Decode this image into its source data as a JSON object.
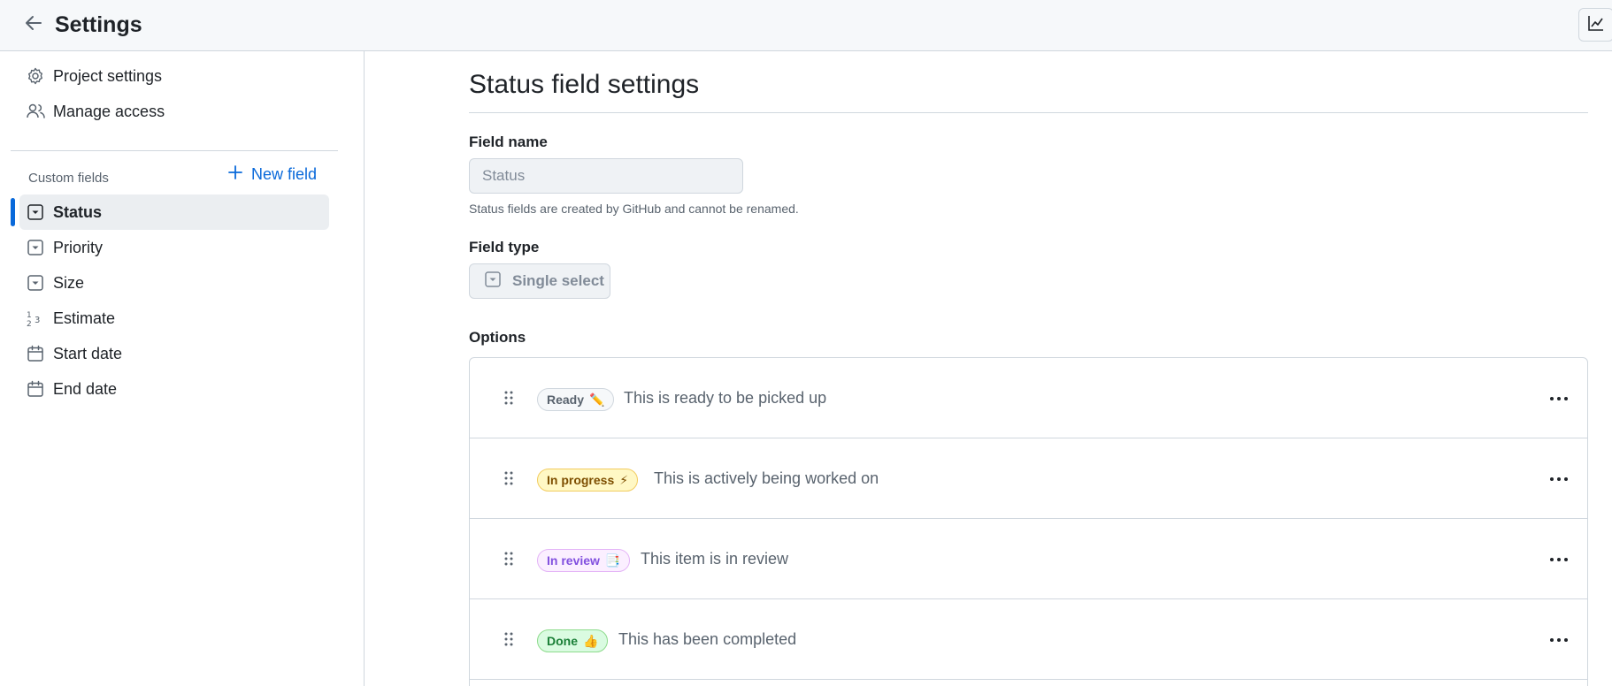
{
  "header": {
    "title": "Settings",
    "back_icon": "arrow-left-icon",
    "insights_icon": "graph-icon"
  },
  "sidebar": {
    "top_items": [
      {
        "label": "Project settings",
        "icon": "gear-icon"
      },
      {
        "label": "Manage access",
        "icon": "people-icon"
      }
    ],
    "section_label": "Custom fields",
    "new_field_label": "New field",
    "fields": [
      {
        "label": "Status",
        "icon": "single-select-icon",
        "active": true
      },
      {
        "label": "Priority",
        "icon": "single-select-icon",
        "active": false
      },
      {
        "label": "Size",
        "icon": "single-select-icon",
        "active": false
      },
      {
        "label": "Estimate",
        "icon": "number-icon",
        "active": false
      },
      {
        "label": "Start date",
        "icon": "calendar-icon",
        "active": false
      },
      {
        "label": "End date",
        "icon": "calendar-icon",
        "active": false
      }
    ],
    "accent_color": "#0969da"
  },
  "main": {
    "title": "Status field settings",
    "field_name_label": "Field name",
    "field_name_value": "Status",
    "field_name_hint": "Status fields are created by GitHub and cannot be renamed.",
    "field_type_label": "Field type",
    "field_type_value": "Single select",
    "options_label": "Options",
    "options": [
      {
        "name": "Ready",
        "emoji": "✏️",
        "description": "This is ready to be picked up",
        "bg": "#f6f8fa",
        "border": "#d0d7de",
        "color": "#59636e"
      },
      {
        "name": "In progress",
        "emoji": "⚡",
        "description": "This is actively being worked on",
        "bg": "#fff8c5",
        "border": "#f2cc60",
        "color": "#7d4e00"
      },
      {
        "name": "In review",
        "emoji": "📑",
        "description": "This item is in review",
        "bg": "#fbefff",
        "border": "#e4b5f7",
        "color": "#8250df"
      },
      {
        "name": "Done",
        "emoji": "👍",
        "description": "This has been completed",
        "bg": "#dafbe1",
        "border": "#8ddb8c",
        "color": "#1a7f37"
      }
    ]
  }
}
